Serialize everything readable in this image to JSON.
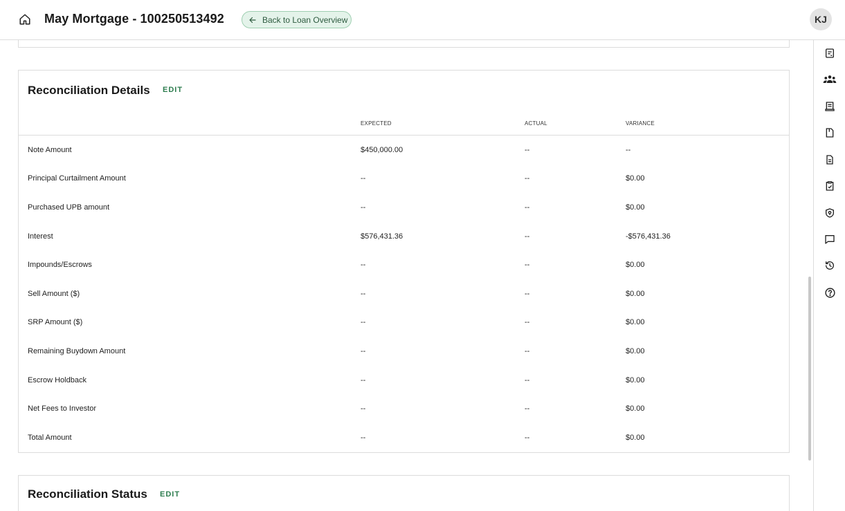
{
  "header": {
    "title": "May Mortgage - 100250513492",
    "back_label": "Back to Loan Overview",
    "avatar_initials": "KJ"
  },
  "rail": {
    "icons": [
      "notes-icon",
      "people-icon",
      "receipt-icon",
      "document-corner-icon",
      "document-text-icon",
      "clipboard-check-icon",
      "shield-lock-icon",
      "chat-icon",
      "history-icon",
      "help-icon"
    ]
  },
  "reconciliation": {
    "title": "Reconciliation Details",
    "edit_label": "EDIT",
    "columns": {
      "expected": "EXPECTED",
      "actual": "ACTUAL",
      "variance": "VARIANCE"
    },
    "rows": [
      {
        "label": "Note Amount",
        "expected": "$450,000.00",
        "actual": "--",
        "variance": "--"
      },
      {
        "label": "Principal Curtailment Amount",
        "expected": "--",
        "actual": "--",
        "variance": "$0.00"
      },
      {
        "label": "Purchased UPB amount",
        "expected": "--",
        "actual": "--",
        "variance": "$0.00"
      },
      {
        "label": "Interest",
        "expected": "$576,431.36",
        "actual": "--",
        "variance": "-$576,431.36"
      },
      {
        "label": "Impounds/Escrows",
        "expected": "--",
        "actual": "--",
        "variance": "$0.00"
      },
      {
        "label": "Sell Amount ($)",
        "expected": "--",
        "actual": "--",
        "variance": "$0.00"
      },
      {
        "label": "SRP Amount ($)",
        "expected": "--",
        "actual": "--",
        "variance": "$0.00"
      },
      {
        "label": "Remaining Buydown Amount",
        "expected": "--",
        "actual": "--",
        "variance": "$0.00"
      },
      {
        "label": "Escrow Holdback",
        "expected": "--",
        "actual": "--",
        "variance": "$0.00"
      },
      {
        "label": "Net Fees to Investor",
        "expected": "--",
        "actual": "--",
        "variance": "$0.00"
      },
      {
        "label": "Total Amount",
        "expected": "--",
        "actual": "--",
        "variance": "$0.00"
      }
    ]
  },
  "status_section": {
    "title": "Reconciliation Status",
    "edit_label": "EDIT"
  },
  "colors": {
    "accent": "#2e7d4f",
    "back_button_bg": "#e4f3ea",
    "border": "#dcdcdc"
  }
}
